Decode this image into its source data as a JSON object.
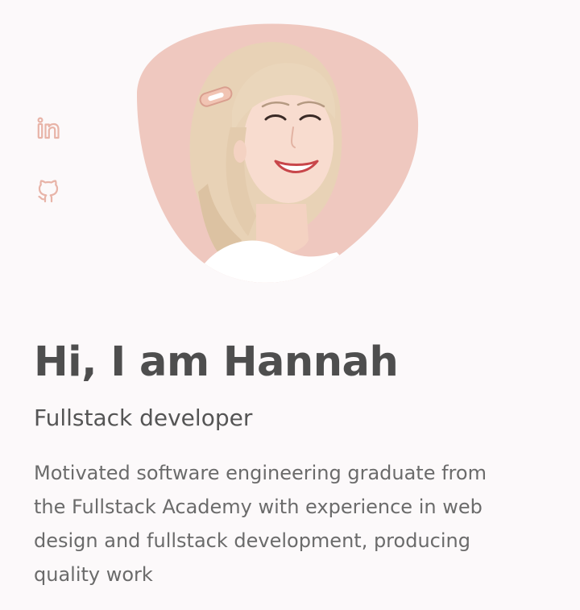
{
  "social": {
    "linkedin_icon": "linkedin-icon",
    "github_icon": "github-icon",
    "icon_color": "#e8b4a8"
  },
  "profile": {
    "photo_bg_color": "#efc8bf"
  },
  "hero": {
    "title": "Hi, I am Hannah",
    "subtitle": "Fullstack developer",
    "description_lines": [
      "Motivated software engineering graduate from",
      "the Fullstack Academy with experience in web",
      "design and fullstack development, producing",
      "quality work"
    ]
  }
}
